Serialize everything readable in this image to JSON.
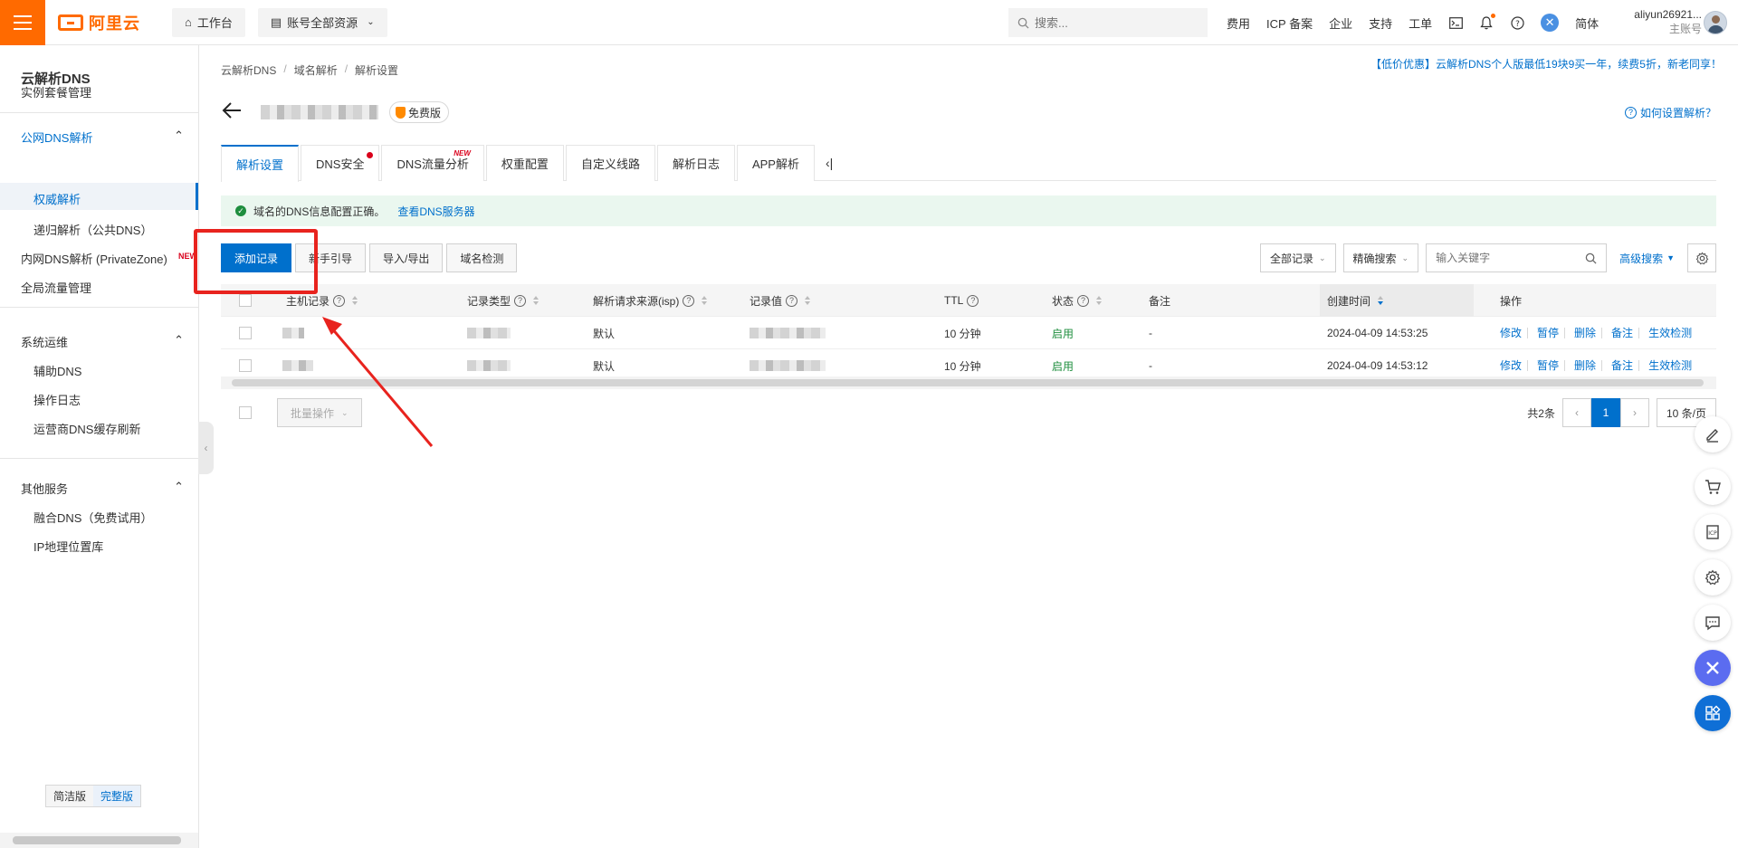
{
  "topbar": {
    "brand": "阿里云",
    "workbench": "工作台",
    "resources": "账号全部资源",
    "search_placeholder": "搜索...",
    "links": [
      "费用",
      "ICP 备案",
      "企业",
      "支持",
      "工单"
    ],
    "lang": "简体",
    "user_name": "aliyun26921...",
    "user_role": "主账号"
  },
  "sidebar": {
    "title": "云解析DNS",
    "instance": "实例套餐管理",
    "public_dns": "公网DNS解析",
    "authoritative": "权威解析",
    "recursive": "递归解析（公共DNS）",
    "private_zone": "内网DNS解析 (PrivateZone)",
    "private_zone_badge": "NEW",
    "global_traffic": "全局流量管理",
    "ops_section": "系统运维",
    "aux_dns": "辅助DNS",
    "op_log": "操作日志",
    "cache_refresh": "运营商DNS缓存刷新",
    "other_section": "其他服务",
    "fusion_dns": "融合DNS（免费试用）",
    "ip_geo": "IP地理位置库",
    "ver_simple": "简洁版",
    "ver_full": "完整版"
  },
  "breadcrumb": [
    "云解析DNS",
    "域名解析",
    "解析设置"
  ],
  "promo": "【低价优惠】云解析DNS个人版最低19块9买一年，续费5折，新老同享！",
  "free_badge": "免费版",
  "howto": "如何设置解析？",
  "tabs": [
    {
      "label": "解析设置"
    },
    {
      "label": "DNS安全"
    },
    {
      "label": "DNS流量分析",
      "tag": "NEW"
    },
    {
      "label": "权重配置"
    },
    {
      "label": "自定义线路"
    },
    {
      "label": "解析日志"
    },
    {
      "label": "APP解析"
    }
  ],
  "notice": {
    "text": "域名的DNS信息配置正确。",
    "link": "查看DNS服务器"
  },
  "actions": {
    "add": "添加记录",
    "guide": "新手引导",
    "import_export": "导入/导出",
    "check": "域名检测"
  },
  "filters": {
    "all_records": "全部记录",
    "exact_search": "精确搜索",
    "keyword_placeholder": "输入关键字",
    "advanced": "高级搜索"
  },
  "table": {
    "headers": {
      "host": "主机记录",
      "type": "记录类型",
      "isp": "解析请求来源(isp)",
      "value": "记录值",
      "ttl": "TTL",
      "status": "状态",
      "remark": "备注",
      "created": "创建时间",
      "ops": "操作"
    },
    "rows": [
      {
        "isp": "默认",
        "ttl": "10 分钟",
        "status": "启用",
        "remark": "-",
        "created": "2024-04-09 14:53:25"
      },
      {
        "isp": "默认",
        "ttl": "10 分钟",
        "status": "启用",
        "remark": "-",
        "created": "2024-04-09 14:53:12"
      }
    ],
    "ops": [
      "修改",
      "暂停",
      "删除",
      "备注",
      "生效检测"
    ]
  },
  "footer": {
    "batch": "批量操作",
    "total": "共2条",
    "current_page": "1",
    "page_size": "10 条/页"
  },
  "colors": {
    "brand": "#ff6a00",
    "primary": "#0070cc",
    "annotation": "#e8231e",
    "enabled": "#1e8e3e"
  }
}
